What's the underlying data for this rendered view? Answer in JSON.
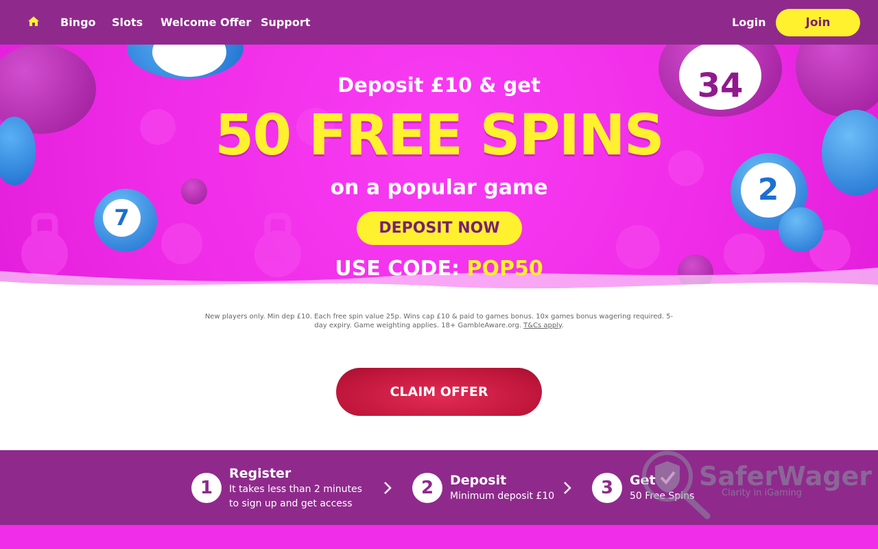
{
  "nav": {
    "home_icon": "home-icon",
    "links": [
      "Bingo",
      "Slots",
      "Welcome Offer",
      "Support"
    ],
    "login": "Login",
    "join": "Join"
  },
  "hero": {
    "line1": "Deposit £10 & get",
    "line2": "50 FREE SPINS",
    "line3": "on a popular game",
    "deposit_button": "DEPOSIT NOW",
    "code_label": "USE CODE:",
    "code_value": "POP50"
  },
  "terms": {
    "text": "New players only. Min dep £10. Each free spin value 25p. Wins cap £10 & paid to games bonus. 10x games bonus wagering required. 5-day expiry. Game weighting applies. 18+ GambleAware.org.",
    "link": "T&Cs apply"
  },
  "claim_button": "CLAIM OFFER",
  "steps": [
    {
      "number": "1",
      "title": "Register",
      "desc1": "It takes less than 2 minutes",
      "desc2": "to sign up and get access"
    },
    {
      "number": "2",
      "title": "Deposit",
      "desc1": "Minimum deposit £10",
      "desc2": ""
    },
    {
      "number": "3",
      "title": "Get",
      "desc1": "50 Free Spins",
      "desc2": ""
    }
  ],
  "watermark": {
    "title": "SaferWager",
    "subtitle": "Clarity in iGaming"
  },
  "colors": {
    "nav_bg": "#8f2a8c",
    "hero_pink": "#f02de8",
    "accent_yellow": "#fff12e",
    "claim_red": "#c0163b"
  }
}
